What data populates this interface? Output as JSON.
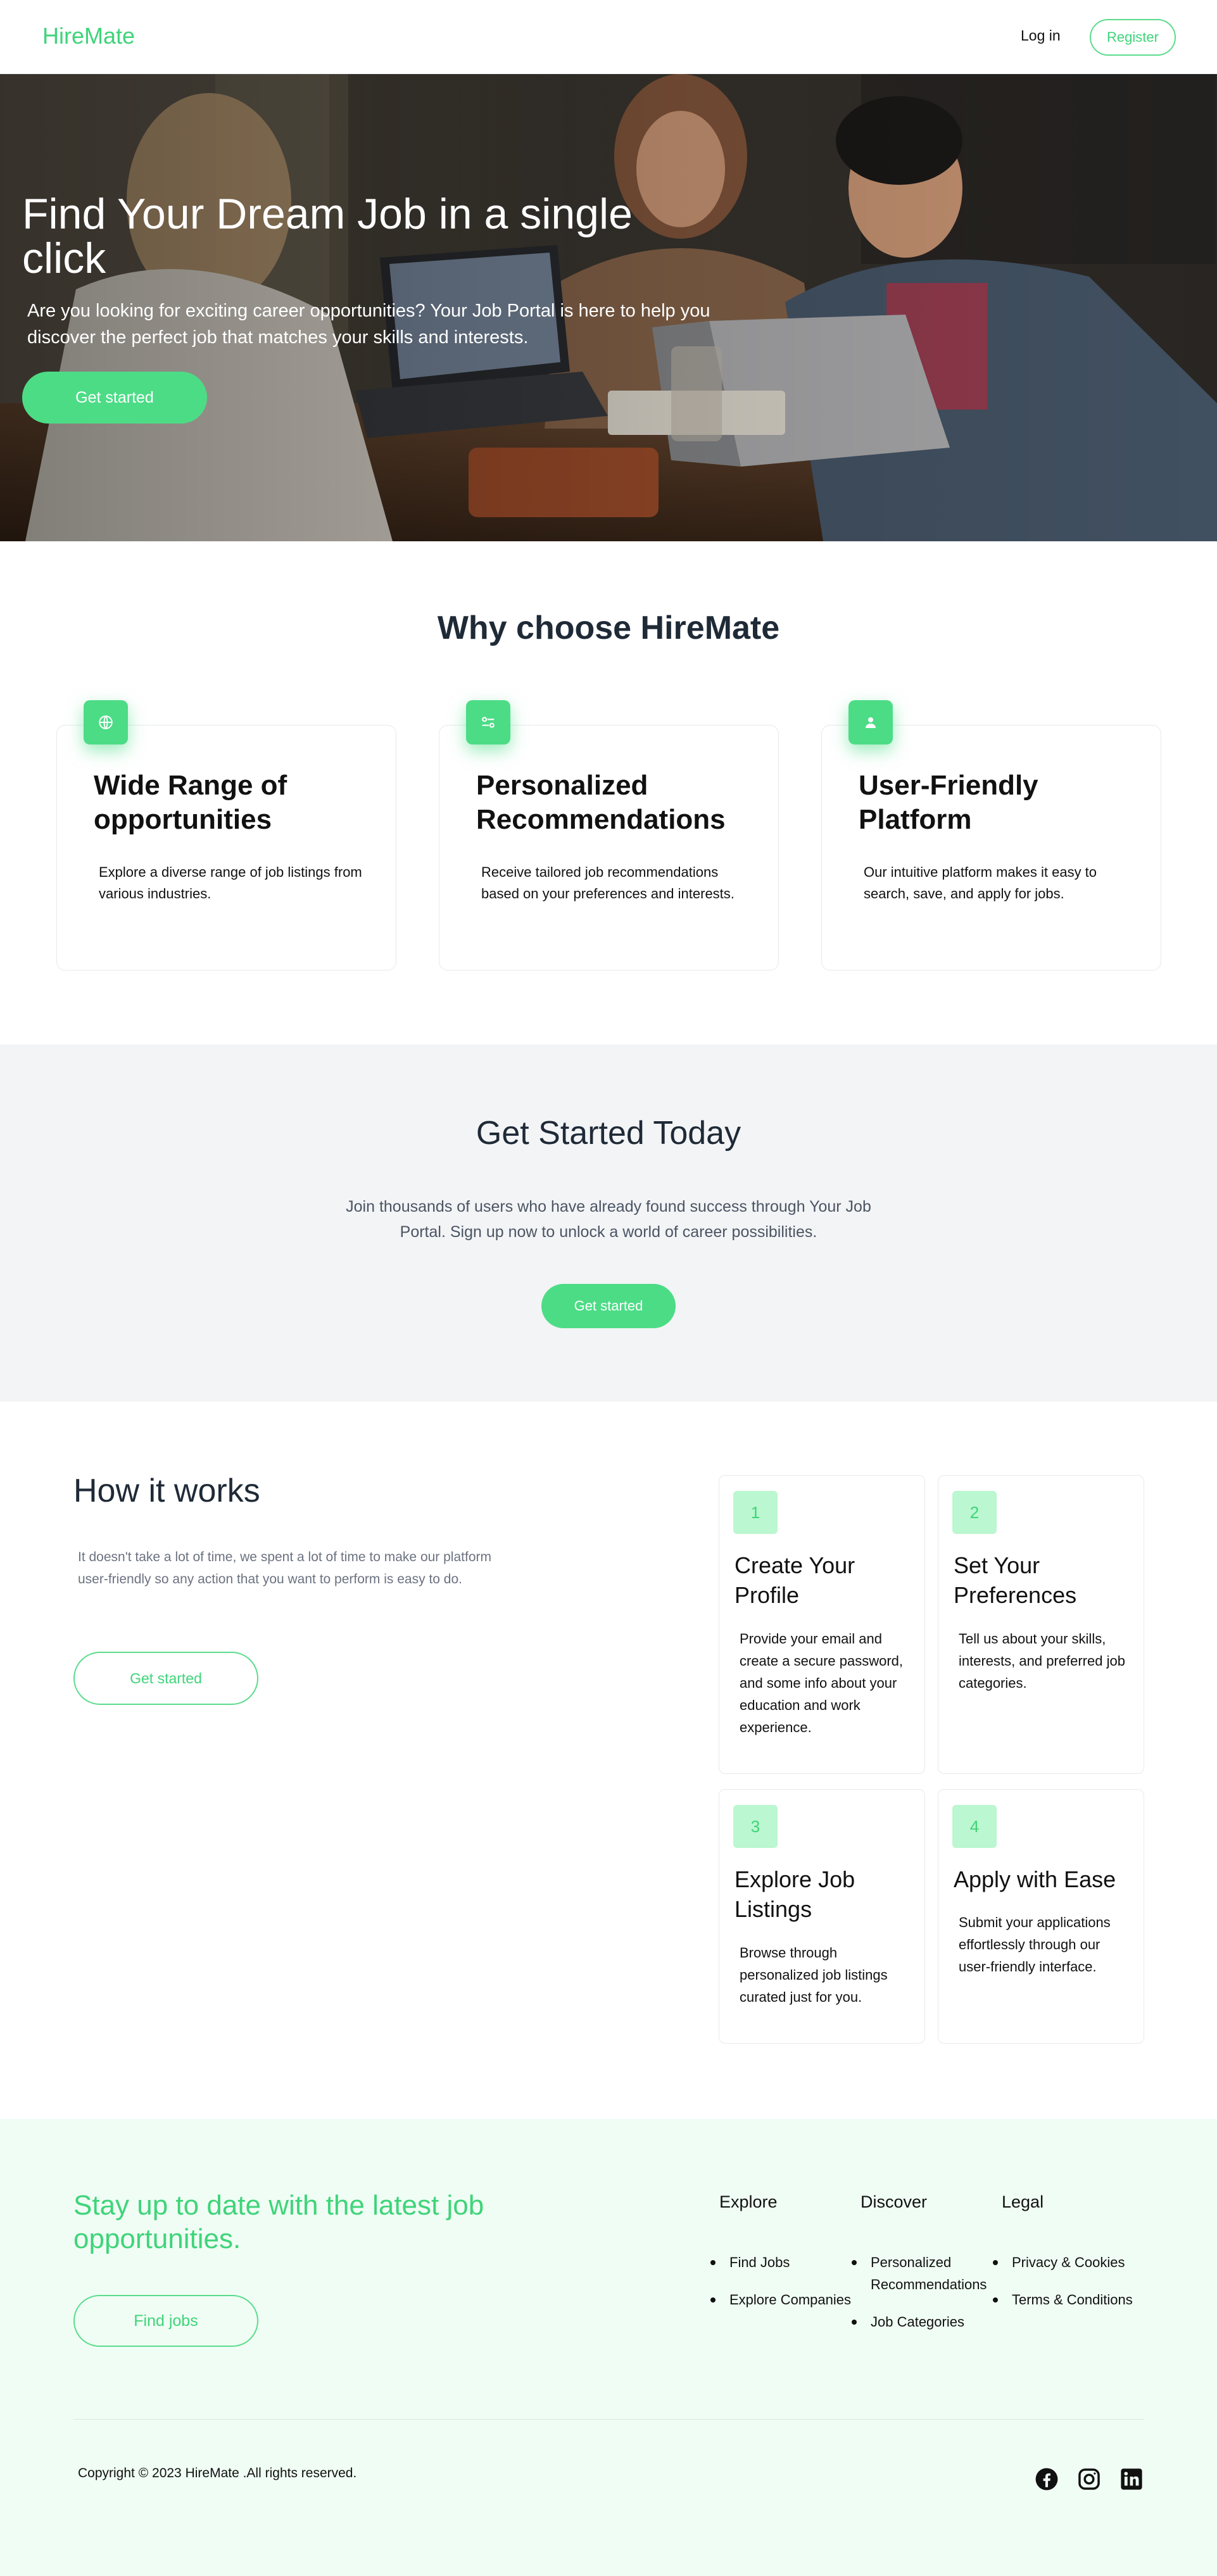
{
  "nav": {
    "brand": "HireMate",
    "login": "Log in",
    "register": "Register"
  },
  "hero": {
    "title": "Find Your Dream Job in a single click",
    "subtitle": "Are you looking for exciting career opportunities? Your Job Portal is here to help you discover the perfect job that matches your skills and interests.",
    "cta": "Get started"
  },
  "why": {
    "title": "Why choose HireMate",
    "cards": [
      {
        "icon": "globe-icon",
        "title": "Wide Range of opportunities",
        "text": "Explore a diverse range of job listings from various industries."
      },
      {
        "icon": "sliders-icon",
        "title": "Personalized Recommendations",
        "text": "Receive tailored job recommendations based on your preferences and interests."
      },
      {
        "icon": "user-icon",
        "title": "User-Friendly Platform",
        "text": "Our intuitive platform makes it easy to search, save, and apply for jobs."
      }
    ]
  },
  "get_started": {
    "title": "Get Started Today",
    "text": "Join thousands of users who have already found success through Your Job Portal. Sign up now to unlock a world of career possibilities.",
    "cta": "Get started"
  },
  "how": {
    "title": "How it works",
    "subtitle": "It doesn't take a lot of time, we spent a lot of time to make our platform user-friendly so any action that you want to perform is easy to do.",
    "cta": "Get started",
    "steps": [
      {
        "num": "1",
        "title": "Create Your Profile",
        "text": "Provide your email and create a secure password, and some info about your education and work experience."
      },
      {
        "num": "2",
        "title": "Set Your Preferences",
        "text": "Tell us about your skills, interests, and preferred job categories."
      },
      {
        "num": "3",
        "title": "Explore Job Listings",
        "text": "Browse through personalized job listings curated just for you."
      },
      {
        "num": "4",
        "title": "Apply with Ease",
        "text": "Submit your applications effortlessly through our user-friendly interface."
      }
    ]
  },
  "footer": {
    "title": "Stay up to date with the latest job opportunities.",
    "cta": "Find jobs",
    "columns": [
      {
        "heading": "Explore",
        "links": [
          "Find Jobs",
          "Explore Companies"
        ]
      },
      {
        "heading": "Discover",
        "links": [
          "Personalized Recommendations",
          "Job Categories"
        ]
      },
      {
        "heading": "Legal",
        "links": [
          "Privacy & Cookies",
          "Terms & Conditions"
        ]
      }
    ],
    "copyright": "Copyright © 2023 HireMate .All rights reserved.",
    "social": [
      "facebook-icon",
      "instagram-icon",
      "linkedin-icon"
    ]
  },
  "colors": {
    "accent": "#4cdc86",
    "accent_text": "#3fd47a",
    "heading": "#1f2a37",
    "footer_bg": "#f0fdf4",
    "section_bg": "#f3f4f6"
  }
}
